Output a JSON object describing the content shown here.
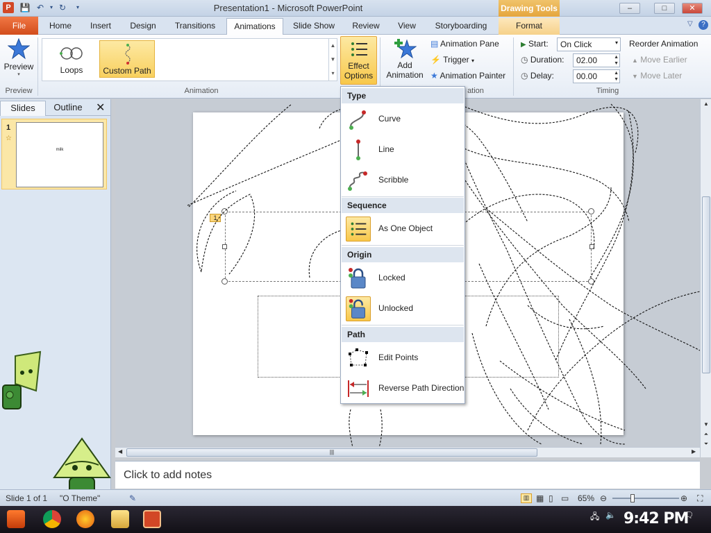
{
  "title_bar": {
    "app_icon": "P",
    "title": "Presentation1 - Microsoft PowerPoint",
    "context_tab": "Drawing Tools",
    "minimize": "–",
    "maximize": "□",
    "close": "✕"
  },
  "tabs": [
    "File",
    "Home",
    "Insert",
    "Design",
    "Transitions",
    "Animations",
    "Slide Show",
    "Review",
    "View",
    "Storyboarding",
    "Format"
  ],
  "ribbon": {
    "preview_group": {
      "button": "Preview",
      "label": "Preview"
    },
    "animation_group": {
      "label": "Animation",
      "gallery": [
        {
          "label": "Loops"
        },
        {
          "label": "Custom Path",
          "selected": true
        }
      ],
      "effect_options": [
        "Effect",
        "Options"
      ]
    },
    "advanced_group": {
      "add_animation": [
        "Add",
        "Animation"
      ],
      "animation_pane": "Animation Pane",
      "trigger": "Trigger",
      "animation_painter": "Animation Painter",
      "label_tail": "ation"
    },
    "timing_group": {
      "label": "Timing",
      "start_label": "Start:",
      "start_value": "On Click",
      "duration_label": "Duration:",
      "duration_value": "02.00",
      "delay_label": "Delay:",
      "delay_value": "00.00",
      "reorder_label": "Reorder Animation",
      "move_earlier": "Move Earlier",
      "move_later": "Move Later"
    }
  },
  "left_pane": {
    "tabs": [
      "Slides",
      "Outline"
    ],
    "close": "✕",
    "thumbnails": [
      {
        "number": "1",
        "text": "milk"
      }
    ]
  },
  "slide": {
    "anim_badge": "1",
    "subtitle_partial": "C                              tle"
  },
  "notes": {
    "placeholder": "Click to add notes"
  },
  "status_bar": {
    "slide_info": "Slide 1 of 1",
    "theme": "\"O    Theme\"",
    "zoom": "65%"
  },
  "taskbar": {
    "clock": "9:42 PM"
  },
  "effect_menu": {
    "sections": [
      {
        "header": "Type",
        "items": [
          {
            "label": "Curve",
            "icon": "curve-path-icon"
          },
          {
            "label": "Line",
            "icon": "line-path-icon"
          },
          {
            "label": "Scribble",
            "icon": "scribble-path-icon"
          }
        ]
      },
      {
        "header": "Sequence",
        "items": [
          {
            "label": "As One Object",
            "icon": "as-one-object-icon",
            "selected": true
          }
        ]
      },
      {
        "header": "Origin",
        "items": [
          {
            "label": "Locked",
            "icon": "locked-icon"
          },
          {
            "label": "Unlocked",
            "icon": "unlocked-icon",
            "selected": true
          }
        ]
      },
      {
        "header": "Path",
        "items": [
          {
            "label": "Edit Points",
            "icon": "edit-points-icon"
          },
          {
            "label": "Reverse Path Direction",
            "icon": "reverse-path-icon"
          }
        ]
      }
    ]
  },
  "colors": {
    "file_tab": "#d24d1c",
    "selected": "#f8c84a",
    "context_tab": "#e5a63d"
  }
}
